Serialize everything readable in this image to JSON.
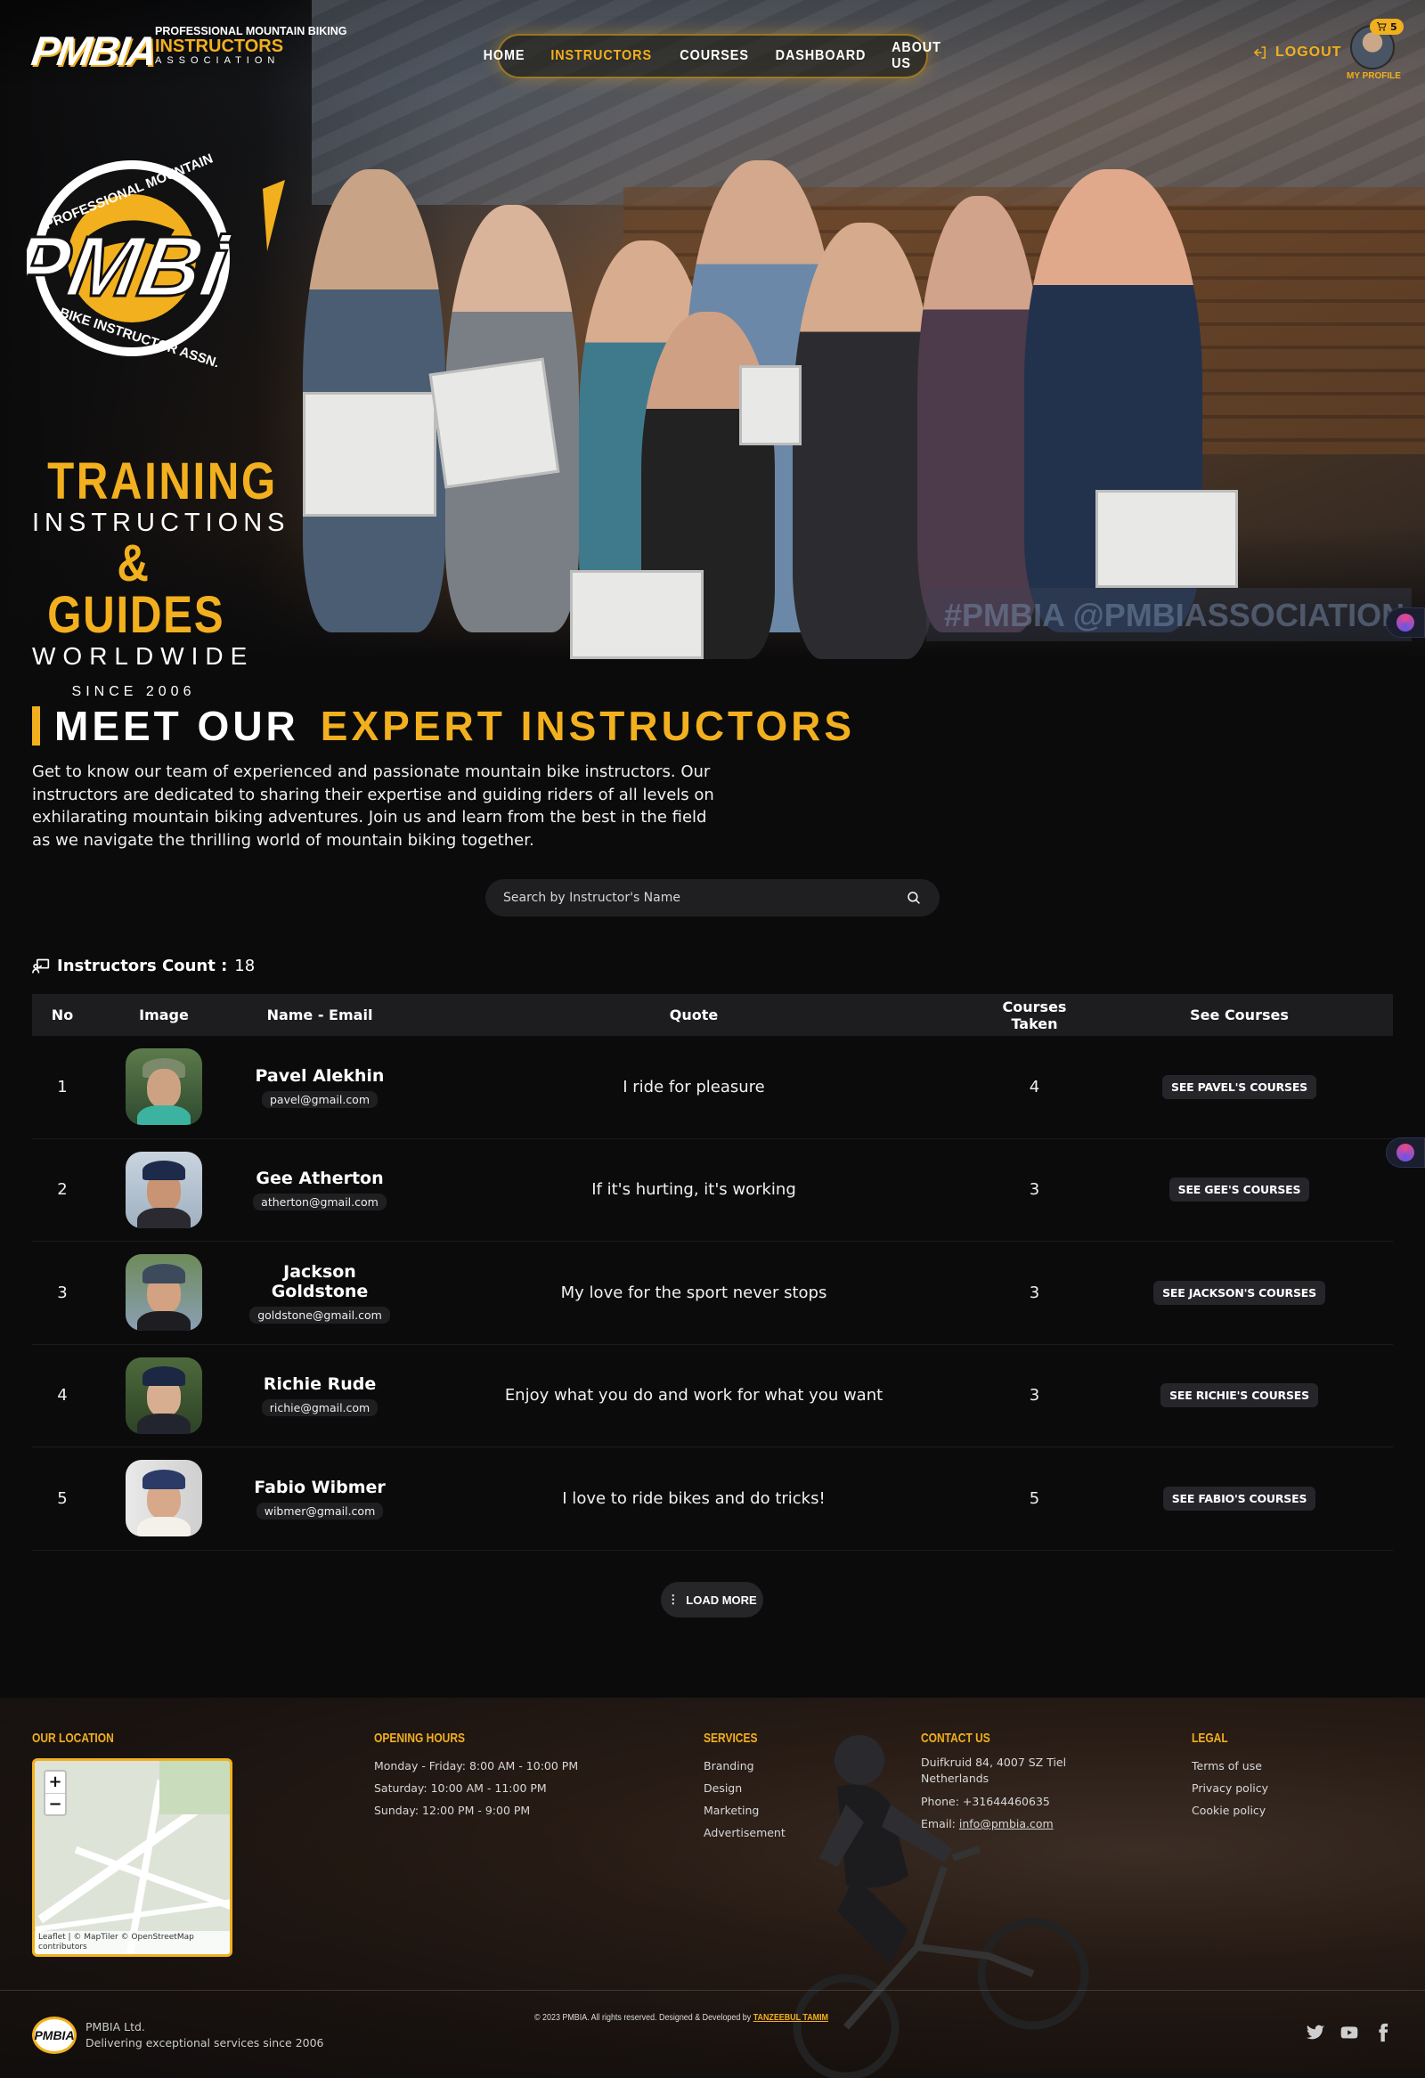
{
  "brand": {
    "mark": "PMBIA",
    "line1": "PROFESSIONAL MOUNTAIN BIKING",
    "line2": "INSTRUCTORS",
    "line3": "ASSOCIATION"
  },
  "nav": {
    "items": [
      "HOME",
      "INSTRUCTORS",
      "COURSES",
      "DASHBOARD",
      "ABOUT US"
    ],
    "active": "INSTRUCTORS",
    "logout": "LOGOUT",
    "profile": "MY PROFILE",
    "cart_count": "5"
  },
  "hero": {
    "badge_top": "PROFESSIONAL MOUNTAIN",
    "badge_mark": "PMBi",
    "badge_bottom": "BIKE INSTRUCTOR ASSN.",
    "tagline": {
      "line1": "TRAINING",
      "line2": "INSTRUCTIONS",
      "line3": "& GUIDES",
      "line4": "WORLDWIDE",
      "line5": "SINCE 2006"
    },
    "watermark": "#PMBIA  @PMBIASSOCIATION"
  },
  "meet": {
    "title_white": "MEET OUR",
    "title_yellow": "EXPERT INSTRUCTORS",
    "description": "Get to know our team of experienced and passionate mountain bike instructors. Our instructors are dedicated to sharing their expertise and guiding riders of all levels on exhilarating mountain biking adventures. Join us and learn from the best in the field as we navigate the thrilling world of mountain biking together."
  },
  "search": {
    "placeholder": "Search by Instructor's Name"
  },
  "count": {
    "label": "Instructors Count :",
    "value": "18"
  },
  "table": {
    "headers": [
      "No",
      "Image",
      "Name - Email",
      "Quote",
      "Courses Taken",
      "See Courses"
    ],
    "rows": [
      {
        "no": "1",
        "name": "Pavel Alekhin",
        "email": "pavel@gmail.com",
        "quote": "I ride for pleasure",
        "courses": "4",
        "button": "SEE PAVEL'S COURSES"
      },
      {
        "no": "2",
        "name": "Gee Atherton",
        "email": "atherton@gmail.com",
        "quote": "If it's hurting, it's working",
        "courses": "3",
        "button": "SEE GEE'S COURSES"
      },
      {
        "no": "3",
        "name": "Jackson Goldstone",
        "email": "goldstone@gmail.com",
        "quote": "My love for the sport never stops",
        "courses": "3",
        "button": "SEE JACKSON'S COURSES"
      },
      {
        "no": "4",
        "name": "Richie Rude",
        "email": "richie@gmail.com",
        "quote": "Enjoy what you do and work for what you want",
        "courses": "3",
        "button": "SEE RICHIE'S COURSES"
      },
      {
        "no": "5",
        "name": "Fabio Wibmer",
        "email": "wibmer@gmail.com",
        "quote": "I love to ride bikes and do tricks!",
        "courses": "5",
        "button": "SEE FABIO'S COURSES"
      }
    ],
    "load_more": "LOAD MORE"
  },
  "footer": {
    "location_title": "OUR LOCATION",
    "map_attribution": "Leaflet | © MapTiler © OpenStreetMap contributors",
    "hours_title": "OPENING HOURS",
    "hours": [
      "Monday - Friday: 8:00 AM - 10:00 PM",
      "Saturday: 10:00 AM - 11:00 PM",
      "Sunday: 12:00 PM - 9:00 PM"
    ],
    "services_title": "SERVICES",
    "services": [
      "Branding",
      "Design",
      "Marketing",
      "Advertisement"
    ],
    "contact_title": "CONTACT US",
    "address": "Duifkruid 84, 4007 SZ Tiel Netherlands",
    "phone": "Phone: +31644460635",
    "email_label": "Email:",
    "email": "info@pmbia.com",
    "legal_title": "LEGAL",
    "legal": [
      "Terms of use",
      "Privacy policy",
      "Cookie policy"
    ],
    "copyright": "© 2023 PMBIA. All rights reserved. Designed & Developed by",
    "developer": "TANZEEBUL TAMIM",
    "company": "PMBIA Ltd.",
    "company_tagline": "Delivering exceptional services since 2006",
    "social": [
      "twitter-icon",
      "youtube-icon",
      "facebook-icon"
    ]
  },
  "colors": {
    "accent": "#f2b01e",
    "background": "#0b0b0c",
    "row_button": "#26262a"
  }
}
